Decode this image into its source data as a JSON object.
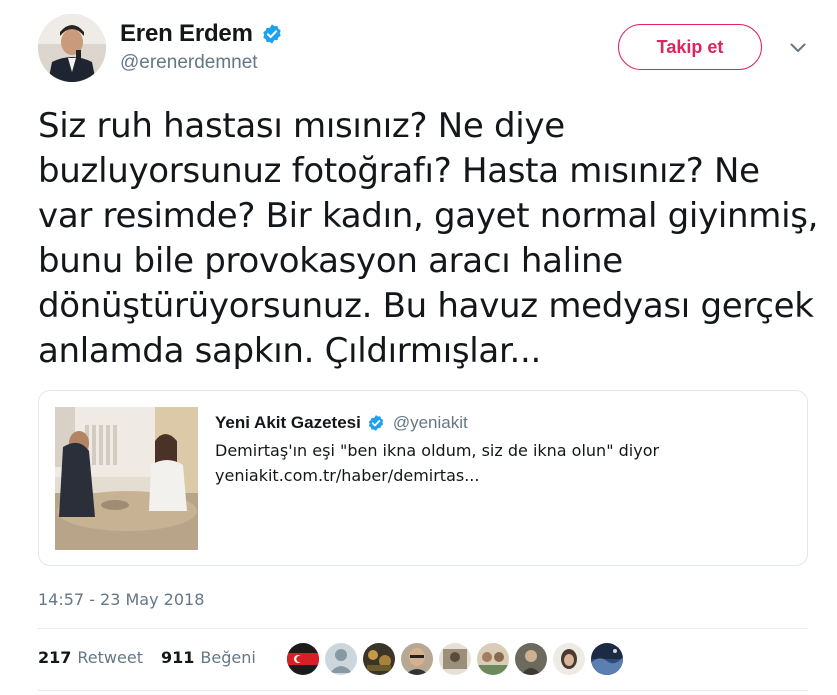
{
  "author": {
    "display_name": "Eren Erdem",
    "handle": "@erenerdemnet",
    "verified": true
  },
  "actions": {
    "follow_label": "Takip et",
    "menu_icon": "chevron-down-icon"
  },
  "tweet": {
    "lines": [
      "Siz ruh hastası mısınız? Ne diye",
      "buzluyorsunuz fotoğrafı? Hasta mısınız? Ne",
      "var resimde? Bir kadın, gayet normal giyinmiş,",
      "bunu bile provokasyon aracı haline",
      "dönüştürüyorsunuz. Bu havuz medyası gerçek",
      "anlamda sapkın. Çıldırmışlar..."
    ],
    "timestamp": "14:57 - 23 May 2018"
  },
  "quoted": {
    "name": "Yeni Akit Gazetesi",
    "handle": "@yeniakit",
    "verified": true,
    "text": "Demirtaş'ın eşi \"ben ikna oldum, siz de ikna olun\" diyor",
    "link": "yeniakit.com.tr/haber/demirtas..."
  },
  "stats": {
    "retweets_count": "217",
    "retweets_label": "Retweet",
    "likes_count": "911",
    "likes_label": "Beğeni"
  },
  "colors": {
    "accent": "#e0245e",
    "verified": "#1da1f2",
    "secondary_text": "#657786",
    "border": "#e1e8ed"
  }
}
